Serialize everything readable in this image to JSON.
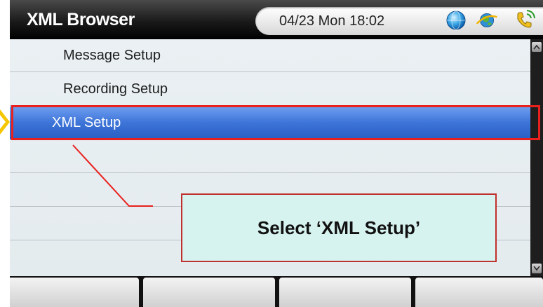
{
  "header": {
    "title": "XML Browser",
    "datetime": "04/23 Mon 18:02",
    "icons": [
      "globe-icon",
      "earth-icon",
      "phone-icon"
    ]
  },
  "menu": {
    "items": [
      {
        "label": "Message Setup",
        "selected": false
      },
      {
        "label": "Recording Setup",
        "selected": false
      },
      {
        "label": "XML Setup",
        "selected": true
      },
      {
        "label": "",
        "selected": false
      },
      {
        "label": "",
        "selected": false
      },
      {
        "label": "",
        "selected": false
      },
      {
        "label": "",
        "selected": false
      }
    ]
  },
  "softkeys": [
    "",
    "",
    "",
    ""
  ],
  "annotation": {
    "callout": "Select ‘XML Setup’",
    "highlight_color": "#e8201e",
    "arrow_color": "#f6c700"
  },
  "colors": {
    "selection": "#3d74d8",
    "list_bg": "#e6edf0",
    "header_bg": "#1a1a1a"
  }
}
